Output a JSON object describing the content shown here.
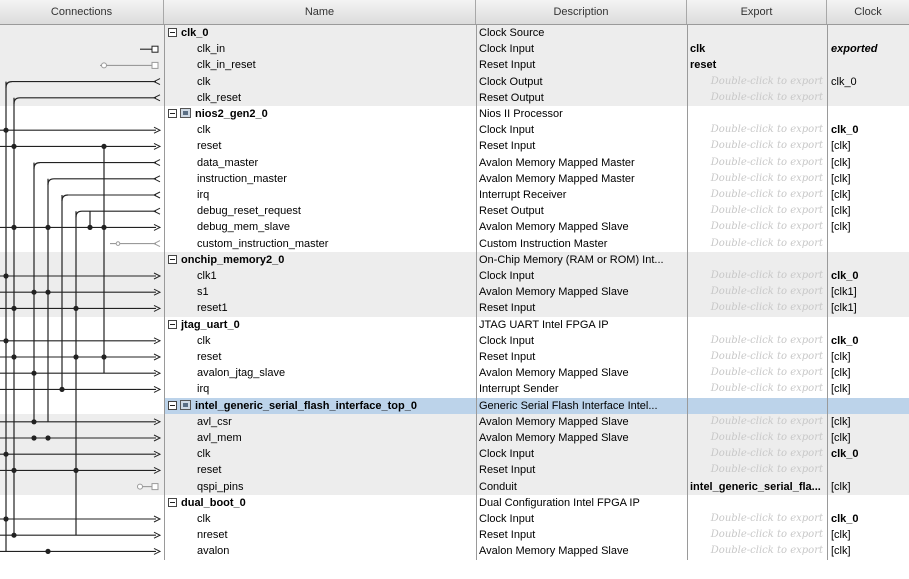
{
  "columns": {
    "connections": "Connections",
    "name": "Name",
    "description": "Description",
    "export": "Export",
    "clock": "Clock"
  },
  "export_hint": "Double-click to export",
  "rows": [
    {
      "kind": "comp",
      "name": "clk_0",
      "desc": "Clock Source",
      "export": "",
      "clock": ""
    },
    {
      "kind": "iface",
      "name": "clk_in",
      "desc": "Clock Input",
      "export": "clk",
      "clock": "exported"
    },
    {
      "kind": "iface",
      "name": "clk_in_reset",
      "desc": "Reset Input",
      "export": "reset",
      "clock": ""
    },
    {
      "kind": "iface",
      "name": "clk",
      "desc": "Clock Output",
      "export": "",
      "clock": "clk_0"
    },
    {
      "kind": "iface",
      "name": "clk_reset",
      "desc": "Reset Output",
      "export": "",
      "clock": ""
    },
    {
      "kind": "comp",
      "icon": true,
      "name": "nios2_gen2_0",
      "desc": "Nios II Processor",
      "export": "",
      "clock": ""
    },
    {
      "kind": "iface",
      "name": "clk",
      "desc": "Clock Input",
      "export": "",
      "clock": "clk_0"
    },
    {
      "kind": "iface",
      "name": "reset",
      "desc": "Reset Input",
      "export": "",
      "clock": "[clk]"
    },
    {
      "kind": "iface",
      "name": "data_master",
      "desc": "Avalon Memory Mapped Master",
      "export": "",
      "clock": "[clk]"
    },
    {
      "kind": "iface",
      "name": "instruction_master",
      "desc": "Avalon Memory Mapped Master",
      "export": "",
      "clock": "[clk]"
    },
    {
      "kind": "iface",
      "name": "irq",
      "desc": "Interrupt Receiver",
      "export": "",
      "clock": "[clk]"
    },
    {
      "kind": "iface",
      "name": "debug_reset_request",
      "desc": "Reset Output",
      "export": "",
      "clock": "[clk]"
    },
    {
      "kind": "iface",
      "name": "debug_mem_slave",
      "desc": "Avalon Memory Mapped Slave",
      "export": "",
      "clock": "[clk]"
    },
    {
      "kind": "iface",
      "name": "custom_instruction_master",
      "desc": "Custom Instruction Master",
      "export": "",
      "clock": ""
    },
    {
      "kind": "comp",
      "name": "onchip_memory2_0",
      "desc": "On-Chip Memory (RAM or ROM) Int...",
      "export": "",
      "clock": ""
    },
    {
      "kind": "iface",
      "name": "clk1",
      "desc": "Clock Input",
      "export": "",
      "clock": "clk_0"
    },
    {
      "kind": "iface",
      "name": "s1",
      "desc": "Avalon Memory Mapped Slave",
      "export": "",
      "clock": "[clk1]"
    },
    {
      "kind": "iface",
      "name": "reset1",
      "desc": "Reset Input",
      "export": "",
      "clock": "[clk1]"
    },
    {
      "kind": "comp",
      "name": "jtag_uart_0",
      "desc": "JTAG UART Intel FPGA IP",
      "export": "",
      "clock": ""
    },
    {
      "kind": "iface",
      "name": "clk",
      "desc": "Clock Input",
      "export": "",
      "clock": "clk_0"
    },
    {
      "kind": "iface",
      "name": "reset",
      "desc": "Reset Input",
      "export": "",
      "clock": "[clk]"
    },
    {
      "kind": "iface",
      "name": "avalon_jtag_slave",
      "desc": "Avalon Memory Mapped Slave",
      "export": "",
      "clock": "[clk]"
    },
    {
      "kind": "iface",
      "name": "irq",
      "desc": "Interrupt Sender",
      "export": "",
      "clock": "[clk]"
    },
    {
      "kind": "comp",
      "icon": true,
      "selected": true,
      "name": "intel_generic_serial_flash_interface_top_0",
      "desc": "Generic Serial Flash Interface Intel...",
      "export": "",
      "clock": ""
    },
    {
      "kind": "iface",
      "name": "avl_csr",
      "desc": "Avalon Memory Mapped Slave",
      "export": "",
      "clock": "[clk]"
    },
    {
      "kind": "iface",
      "name": "avl_mem",
      "desc": "Avalon Memory Mapped Slave",
      "export": "",
      "clock": "[clk]"
    },
    {
      "kind": "iface",
      "name": "clk",
      "desc": "Clock Input",
      "export": "",
      "clock": "clk_0"
    },
    {
      "kind": "iface",
      "name": "reset",
      "desc": "Reset Input",
      "export": "",
      "clock": ""
    },
    {
      "kind": "iface",
      "name": "qspi_pins",
      "desc": "Conduit",
      "export": "intel_generic_serial_fla...",
      "clock": "[clk]"
    },
    {
      "kind": "comp",
      "name": "dual_boot_0",
      "desc": "Dual Configuration Intel FPGA IP",
      "export": "",
      "clock": ""
    },
    {
      "kind": "iface",
      "name": "clk",
      "desc": "Clock Input",
      "export": "",
      "clock": "clk_0"
    },
    {
      "kind": "iface",
      "name": "nreset",
      "desc": "Reset Input",
      "export": "",
      "clock": "[clk]"
    },
    {
      "kind": "iface",
      "name": "avalon",
      "desc": "Avalon Memory Mapped Slave",
      "export": "",
      "clock": "[clk]"
    }
  ]
}
